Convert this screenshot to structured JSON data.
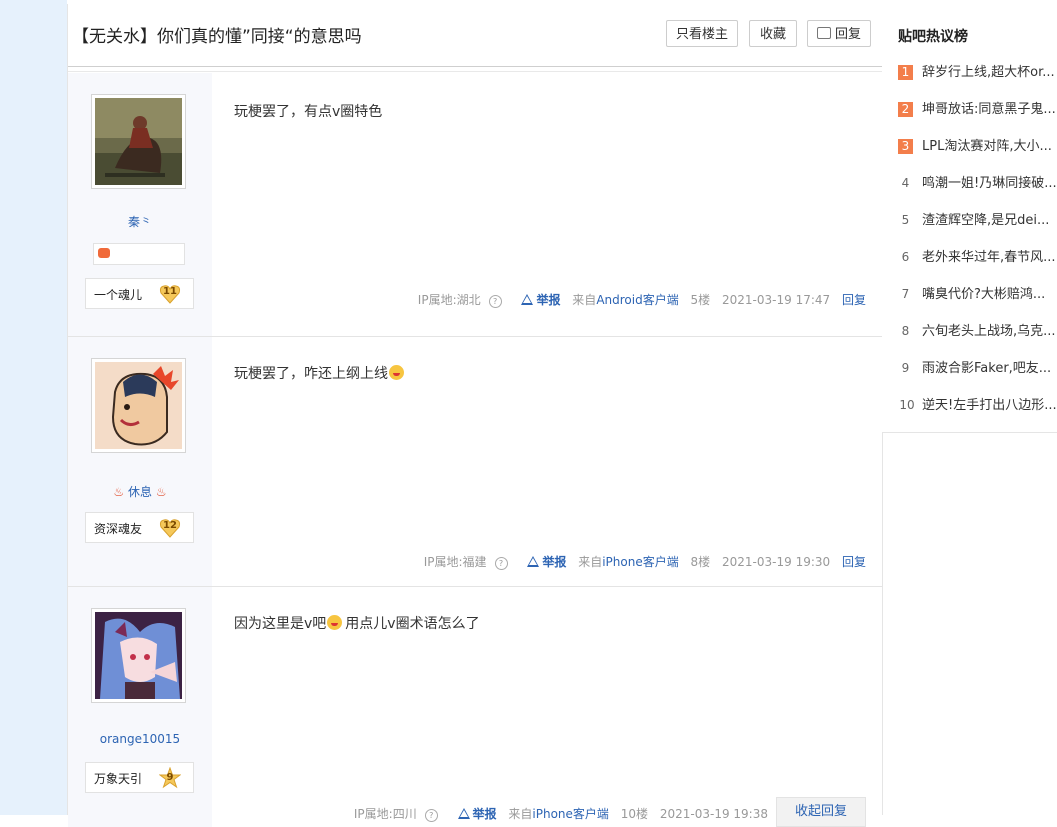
{
  "thread": {
    "title": "【无关水】你们真的懂”同接“的意思吗",
    "buttons": {
      "only_op": "只看楼主",
      "favorite": "收藏",
      "reply": "回复"
    }
  },
  "posts": [
    {
      "username": "秦⺀",
      "level_name": "一个魂儿",
      "level": "11",
      "content": "玩梗罢了，有点v圈特色",
      "ip": "IP属地:湖北",
      "report": "举报",
      "from_prefix": "来自",
      "client": "Android客户端",
      "floor": "5楼",
      "time": "2021-03-19 17:47",
      "reply": "回复"
    },
    {
      "username_deco": "♨",
      "username": "休息",
      "level_name": "资深魂友",
      "level": "12",
      "content": "玩梗罢了，咋还上纲上线",
      "ip": "IP属地:福建",
      "report": "举报",
      "from_prefix": "来自",
      "client": "iPhone客户端",
      "floor": "8楼",
      "time": "2021-03-19 19:30",
      "reply": "回复"
    },
    {
      "username": "orange10015",
      "level_name": "万象天引",
      "level": "9",
      "content_pre": "因为这里是v吧",
      "content_post": "用点儿v圈术语怎么了",
      "ip": "IP属地:四川",
      "report": "举报",
      "from_prefix": "来自",
      "client": "iPhone客户端",
      "floor": "10楼",
      "time": "2021-03-19 19:38",
      "collapse": "收起回复"
    }
  ],
  "sidebar": {
    "title": "贴吧热议榜",
    "items": [
      {
        "rank": "1",
        "text": "辞岁行上线,超大杯or..."
      },
      {
        "rank": "2",
        "text": "坤哥放话:同意黑子鬼..."
      },
      {
        "rank": "3",
        "text": "LPL淘汰赛对阵,大小..."
      },
      {
        "rank": "4",
        "text": "鸣潮一姐!乃琳同接破..."
      },
      {
        "rank": "5",
        "text": "渣渣辉空降,是兄dei..."
      },
      {
        "rank": "6",
        "text": "老外来华过年,春节风..."
      },
      {
        "rank": "7",
        "text": "嘴臭代价?大彬赔鸿..."
      },
      {
        "rank": "8",
        "text": "六旬老头上战场,乌克..."
      },
      {
        "rank": "9",
        "text": "雨波合影Faker,吧友..."
      },
      {
        "rank": "10",
        "text": "逆天!左手打出八边形..."
      }
    ]
  },
  "colors": {
    "accent": "#2d64b3",
    "hot_rank": "#f37e4b",
    "left_bg": "#e6f1fc"
  }
}
